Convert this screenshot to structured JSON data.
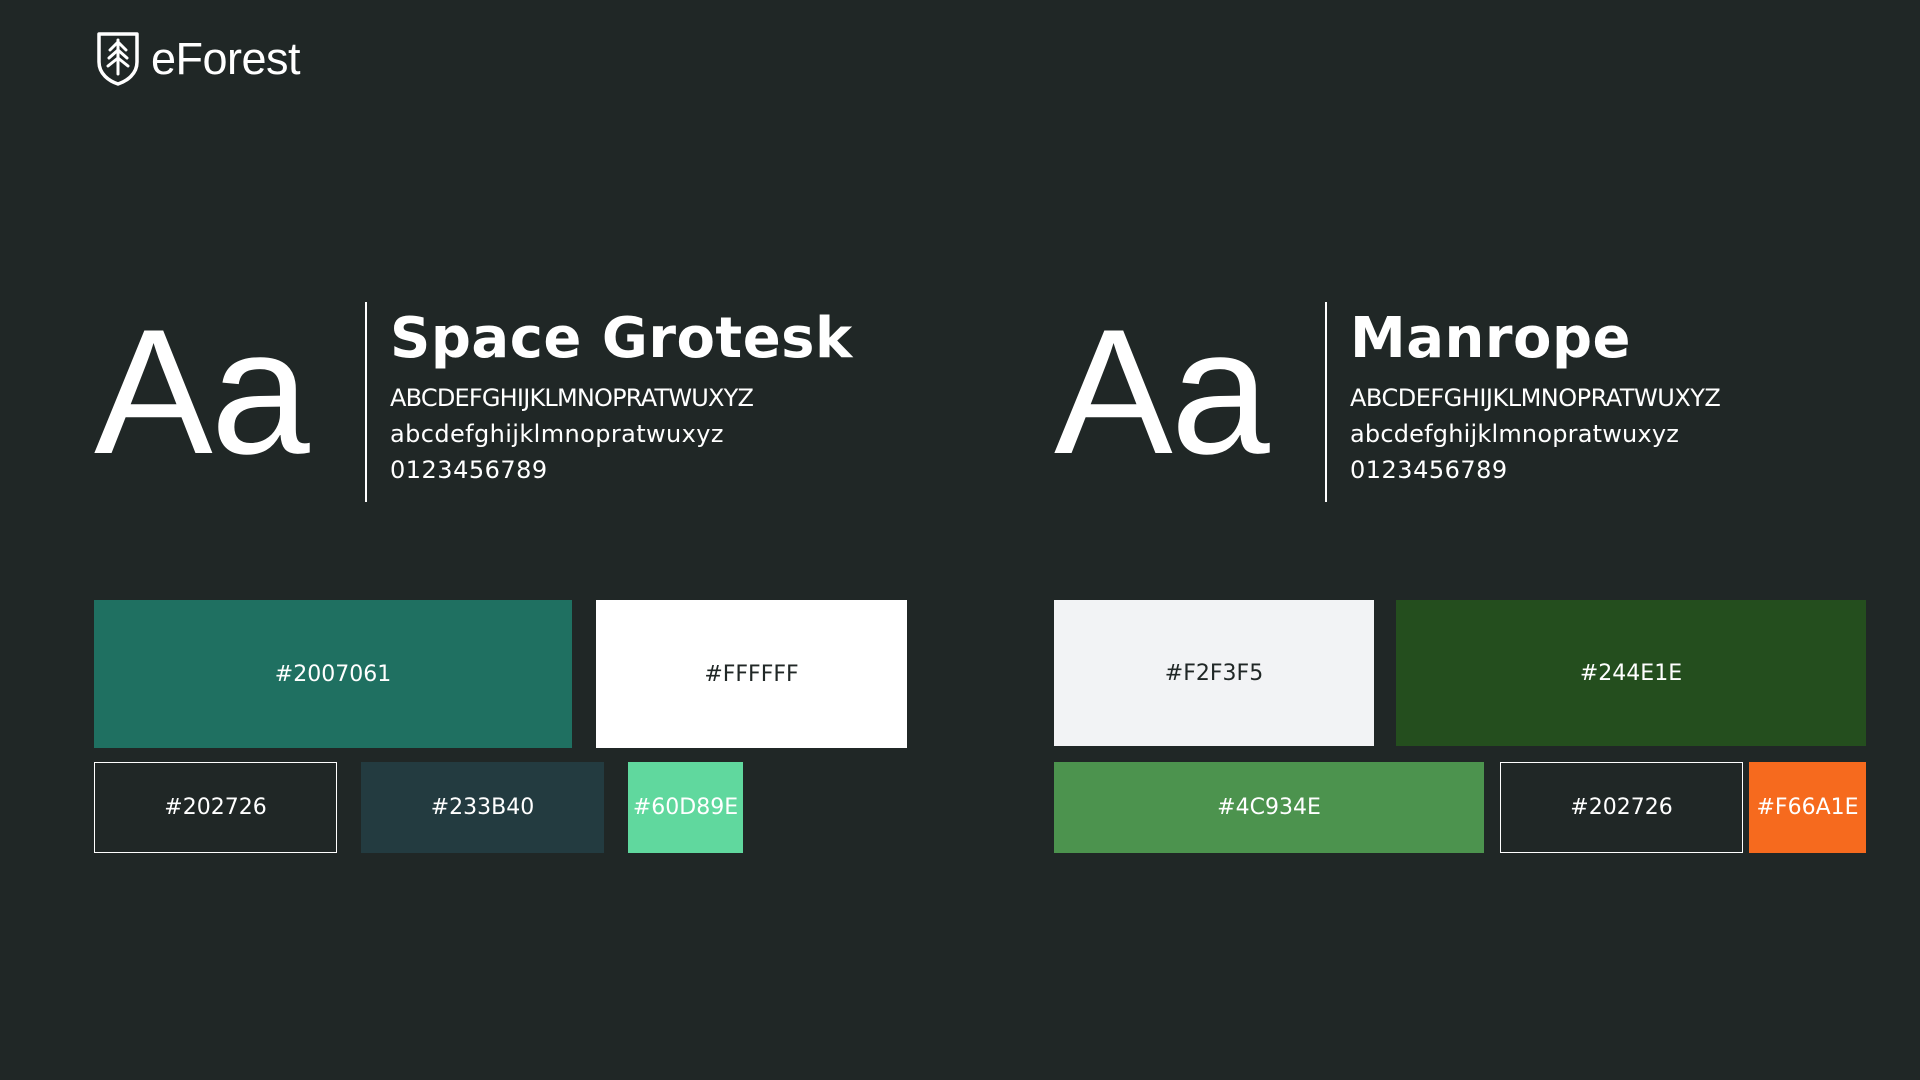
{
  "brand": {
    "name": "eForest",
    "logo_icon": "shield-tree-icon"
  },
  "fonts": [
    {
      "sample_glyphs": "Aa",
      "name": "Space Grotesk",
      "uppercase": "ABCDEFGHIJKLMNOPRATWUXYZ",
      "lowercase": "abcdefghijklmnopratwuxyz",
      "digits": "0123456789"
    },
    {
      "sample_glyphs": "Aa",
      "name": "Manrope",
      "uppercase": "ABCDEFGHIJKLMNOPRATWUXYZ",
      "lowercase": "abcdefghijklmnopratwuxyz",
      "digits": "0123456789"
    }
  ],
  "palettes": [
    {
      "swatches": [
        {
          "label": "#2007061",
          "color": "#1F7061"
        },
        {
          "label": "#FFFFFF",
          "color": "#FFFFFF"
        },
        {
          "label": "#202726",
          "color": "#202726"
        },
        {
          "label": "#233B40",
          "color": "#233B40"
        },
        {
          "label": "#60D89E",
          "color": "#60D89E"
        }
      ]
    },
    {
      "swatches": [
        {
          "label": "#F2F3F5",
          "color": "#F2F3F5"
        },
        {
          "label": "#244E1E",
          "color": "#244E1E"
        },
        {
          "label": "#4C934E",
          "color": "#4C934E"
        },
        {
          "label": "#202726",
          "color": "#202726"
        },
        {
          "label": "#F66A1E",
          "color": "#F66A1E"
        }
      ]
    }
  ],
  "background_color": "#202726"
}
